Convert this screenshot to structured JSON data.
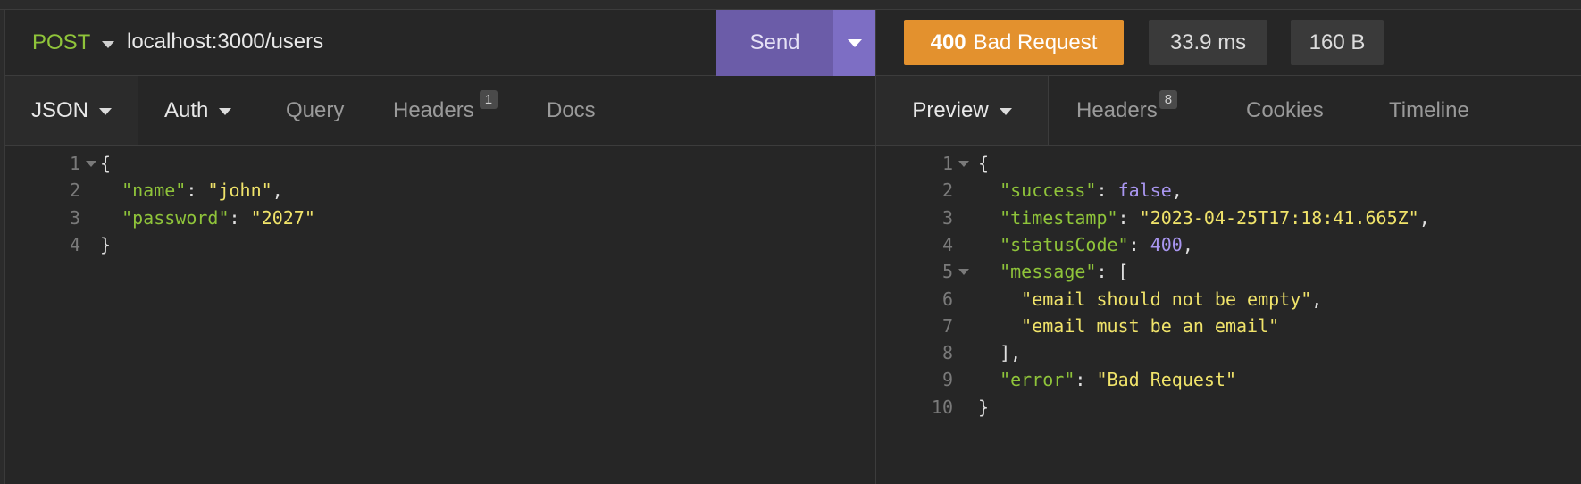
{
  "request": {
    "method": "POST",
    "url": "localhost:3000/users",
    "send_label": "Send",
    "tabs": [
      {
        "label": "JSON",
        "dropdown": true
      },
      {
        "label": "Auth",
        "dropdown": true
      },
      {
        "label": "Query"
      },
      {
        "label": "Headers",
        "badge": "1"
      },
      {
        "label": "Docs"
      }
    ],
    "body_lines": [
      {
        "n": "1",
        "fold": true,
        "parts": [
          [
            "p",
            "{"
          ]
        ]
      },
      {
        "n": "2",
        "parts": [
          [
            "p",
            "  "
          ],
          [
            "k",
            "\"name\""
          ],
          [
            "p",
            ": "
          ],
          [
            "s",
            "\"john\""
          ],
          [
            "p",
            ","
          ]
        ]
      },
      {
        "n": "3",
        "parts": [
          [
            "p",
            "  "
          ],
          [
            "k",
            "\"password\""
          ],
          [
            "p",
            ": "
          ],
          [
            "s",
            "\"2027\""
          ]
        ]
      },
      {
        "n": "4",
        "parts": [
          [
            "p",
            "}"
          ]
        ]
      }
    ]
  },
  "response": {
    "status_code": "400",
    "status_text": "Bad Request",
    "time": "33.9 ms",
    "size": "160 B",
    "tabs": [
      {
        "label": "Preview",
        "dropdown": true
      },
      {
        "label": "Headers",
        "badge": "8"
      },
      {
        "label": "Cookies"
      },
      {
        "label": "Timeline"
      }
    ],
    "body_lines": [
      {
        "n": "1",
        "fold": true,
        "parts": [
          [
            "p",
            "{"
          ]
        ]
      },
      {
        "n": "2",
        "parts": [
          [
            "p",
            "  "
          ],
          [
            "k",
            "\"success\""
          ],
          [
            "p",
            ": "
          ],
          [
            "b",
            "false"
          ],
          [
            "p",
            ","
          ]
        ]
      },
      {
        "n": "3",
        "parts": [
          [
            "p",
            "  "
          ],
          [
            "k",
            "\"timestamp\""
          ],
          [
            "p",
            ": "
          ],
          [
            "s",
            "\"2023-04-25T17:18:41.665Z\""
          ],
          [
            "p",
            ","
          ]
        ]
      },
      {
        "n": "4",
        "parts": [
          [
            "p",
            "  "
          ],
          [
            "k",
            "\"statusCode\""
          ],
          [
            "p",
            ": "
          ],
          [
            "n",
            "400"
          ],
          [
            "p",
            ","
          ]
        ]
      },
      {
        "n": "5",
        "fold": true,
        "parts": [
          [
            "p",
            "  "
          ],
          [
            "k",
            "\"message\""
          ],
          [
            "p",
            ": ["
          ]
        ]
      },
      {
        "n": "6",
        "parts": [
          [
            "p",
            "    "
          ],
          [
            "s",
            "\"email should not be empty\""
          ],
          [
            "p",
            ","
          ]
        ]
      },
      {
        "n": "7",
        "parts": [
          [
            "p",
            "    "
          ],
          [
            "s",
            "\"email must be an email\""
          ]
        ]
      },
      {
        "n": "8",
        "parts": [
          [
            "p",
            "  ],"
          ]
        ]
      },
      {
        "n": "9",
        "parts": [
          [
            "p",
            "  "
          ],
          [
            "k",
            "\"error\""
          ],
          [
            "p",
            ": "
          ],
          [
            "s",
            "\"Bad Request\""
          ]
        ]
      },
      {
        "n": "10",
        "parts": [
          [
            "p",
            "}"
          ]
        ]
      }
    ]
  },
  "colors": {
    "method": "#8fc43a",
    "send": "#6b5ca8",
    "send_caret": "#7d6ec4",
    "status_400": "#e3912e",
    "json_key": "#8fc43a",
    "json_string": "#f0e36a",
    "json_literal": "#a996f0"
  }
}
